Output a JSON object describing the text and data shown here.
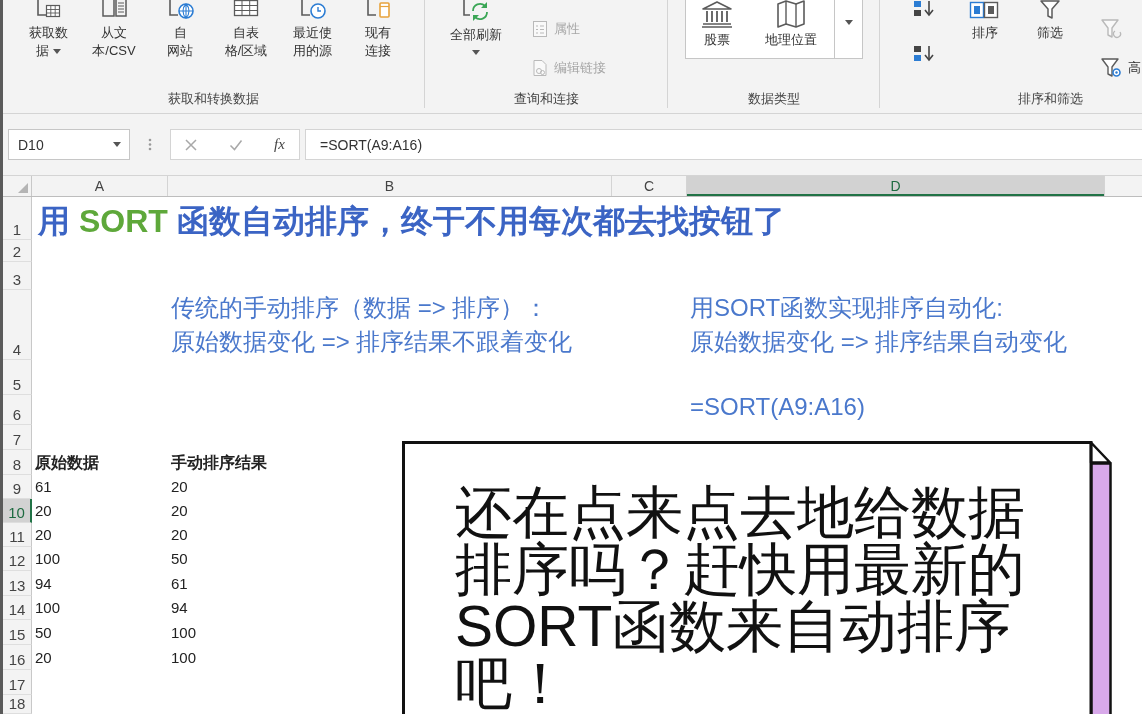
{
  "ribbon": {
    "groups": [
      {
        "label": "获取和转换数据",
        "buttons": [
          {
            "kind": "large",
            "lines": [
              "获取数",
              "据"
            ],
            "dropdown": true,
            "disabled": false
          },
          {
            "kind": "large",
            "lines": [
              "从文",
              "本/CSV"
            ],
            "dropdown": false,
            "disabled": false
          },
          {
            "kind": "large",
            "lines": [
              "自",
              "网站"
            ],
            "dropdown": false,
            "disabled": false
          },
          {
            "kind": "large",
            "lines": [
              "自表",
              "格/区域"
            ],
            "dropdown": false,
            "disabled": false
          },
          {
            "kind": "large",
            "lines": [
              "最近使",
              "用的源"
            ],
            "dropdown": false,
            "disabled": false
          },
          {
            "kind": "large",
            "lines": [
              "现有",
              "连接"
            ],
            "dropdown": false,
            "disabled": false
          }
        ]
      },
      {
        "label": "查询和连接",
        "buttons": [
          {
            "kind": "large",
            "lines": [
              "全部刷新"
            ],
            "dropdown": true,
            "disabled": false
          },
          {
            "kind": "small",
            "lines": [
              "属性"
            ],
            "dropdown": false,
            "disabled": true
          },
          {
            "kind": "small",
            "lines": [
              "编辑链接"
            ],
            "dropdown": false,
            "disabled": true
          }
        ]
      },
      {
        "label": "数据类型",
        "buttons": [
          {
            "kind": "gallery",
            "lines": [
              "股票"
            ],
            "dropdown": false,
            "disabled": false
          },
          {
            "kind": "gallery",
            "lines": [
              "地理位置"
            ],
            "dropdown": false,
            "disabled": false
          },
          {
            "kind": "more",
            "dropdown": true,
            "disabled": false
          }
        ]
      },
      {
        "label": "排序和筛选",
        "buttons": [
          {
            "kind": "icon",
            "dropdown": false,
            "disabled": false
          },
          {
            "kind": "icon",
            "dropdown": false,
            "disabled": false
          },
          {
            "kind": "large",
            "lines": [
              "排序"
            ],
            "dropdown": false,
            "disabled": false
          },
          {
            "kind": "large",
            "lines": [
              "筛选"
            ],
            "dropdown": false,
            "disabled": false
          },
          {
            "kind": "small",
            "dropdown": false,
            "disabled": true
          },
          {
            "kind": "small",
            "lines": [
              "高"
            ],
            "dropdown": false,
            "disabled": false
          }
        ]
      }
    ]
  },
  "formula_bar": {
    "name_box": "D10",
    "insert_function": "fx",
    "formula": "=SORT(A9:A16)"
  },
  "sheet": {
    "columns": [
      {
        "label": "A",
        "selected": false
      },
      {
        "label": "B",
        "selected": false
      },
      {
        "label": "C",
        "selected": false
      },
      {
        "label": "D",
        "selected": true
      },
      {
        "selected": false
      }
    ],
    "rows": [
      {
        "label": "1",
        "selected": false,
        "kind": "title",
        "parts": [
          {
            "text": "用 ",
            "kind": "plain"
          },
          {
            "text": "SORT",
            "kind": "accent"
          },
          {
            "text": " 函数自动排序，终于不用每次都去找按钮了",
            "kind": "plain"
          }
        ]
      },
      {
        "label": "2",
        "selected": false,
        "kind": "blank"
      },
      {
        "label": "3",
        "selected": false,
        "kind": "blank"
      },
      {
        "label": "4",
        "selected": false,
        "kind": "note",
        "b": [
          "传统的手动排序（数据 => 排序）：",
          "原始数据变化 => 排序结果不跟着变化"
        ],
        "d": [
          "用SORT函数实现排序自动化:",
          "原始数据变化 => 排序结果自动变化"
        ]
      },
      {
        "label": "5",
        "selected": false,
        "kind": "blank"
      },
      {
        "label": "6",
        "selected": false,
        "kind": "note",
        "d": [
          "=SORT(A9:A16)"
        ]
      },
      {
        "label": "7",
        "selected": false,
        "kind": "blank"
      },
      {
        "label": "8",
        "selected": false,
        "kind": "header",
        "a": "原始数据",
        "b": "手动排序结果"
      },
      {
        "label": "9",
        "selected": false,
        "kind": "data",
        "a": "61",
        "b": "20"
      },
      {
        "label": "10",
        "selected": true,
        "kind": "data",
        "a": "20",
        "b": "20"
      },
      {
        "label": "11",
        "selected": false,
        "kind": "data",
        "a": "20",
        "b": "20"
      },
      {
        "label": "12",
        "selected": false,
        "kind": "data",
        "a": "100",
        "b": "50"
      },
      {
        "label": "13",
        "selected": false,
        "kind": "data",
        "a": "94",
        "b": "61"
      },
      {
        "label": "14",
        "selected": false,
        "kind": "data",
        "a": "100",
        "b": "94"
      },
      {
        "label": "15",
        "selected": false,
        "kind": "data",
        "a": "50",
        "b": "100"
      },
      {
        "label": "16",
        "selected": false,
        "kind": "data",
        "a": "20",
        "b": "100"
      },
      {
        "label": "17",
        "selected": false,
        "kind": "blank"
      },
      {
        "label": "18",
        "selected": false,
        "kind": "blank"
      }
    ]
  },
  "callout": {
    "text": "还在点来点去地给数据排序吗？赶快用最新的SORT函数来自动排序吧！"
  }
}
